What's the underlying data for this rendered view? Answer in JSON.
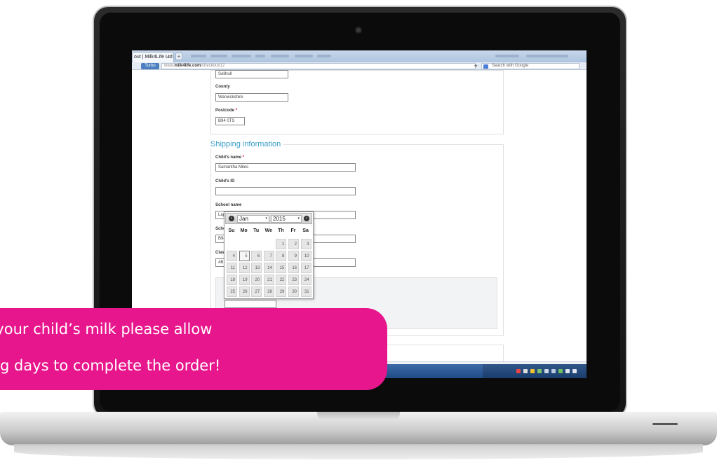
{
  "browser": {
    "tab_title": "out | Milk4Life Ltd",
    "tab_close": "×",
    "new_tab": "+",
    "turbo_label": "Turbo",
    "url_prefix": "www.",
    "url_domain": "milk4life.com",
    "url_path": "/checkout/12",
    "search_placeholder": "Search with Google"
  },
  "address_section": {
    "town_value": "Solihull",
    "county_label": "County",
    "county_value": "Warwickshire",
    "postcode_label": "Postcode",
    "postcode_value": "B94 0TS",
    "required_mark": "*"
  },
  "shipping": {
    "legend": "Shipping information",
    "childs_name_label": "Child's name",
    "childs_name_value": "Samantha Miles",
    "childs_id_label": "Child's ID",
    "childs_id_value": "",
    "school_name_label": "School name",
    "school_name_value": "Lap",
    "school_second_label": "Scho",
    "school_second_value": "B94",
    "class_label": "Clas",
    "class_value": "4B"
  },
  "datepicker": {
    "prev_icon": "‹",
    "next_icon": "›",
    "month": "Jan",
    "year": "2015",
    "dropdown_arrow": "▾",
    "weekdays": [
      "Su",
      "Mo",
      "Tu",
      "We",
      "Th",
      "Fr",
      "Sa"
    ],
    "days": [
      "1",
      "2",
      "3",
      "4",
      "5",
      "6",
      "7",
      "8",
      "9",
      "10",
      "11",
      "12",
      "13",
      "14",
      "15",
      "16",
      "17",
      "18",
      "19",
      "20",
      "21",
      "22",
      "23",
      "24",
      "25",
      "26",
      "27",
      "28",
      "29",
      "30",
      "31"
    ],
    "first_weekday_index": 4,
    "highlighted_day": "5"
  },
  "banner": {
    "line1": "ng your child’s milk please allow",
    "line2": "rking days to complete the order!"
  },
  "colors": {
    "accent_pink": "#e8168c",
    "legend_blue": "#3a9ec9",
    "taskbar_blue": "#2b5a96"
  }
}
